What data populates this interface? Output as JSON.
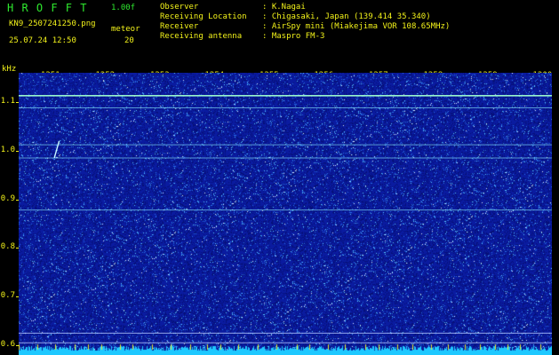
{
  "header": {
    "program_title": "H R O F F T",
    "version": "1.00f",
    "filename": "KN9_2507241250.png",
    "date_time": "25.07.24 12:50",
    "mode": "meteor",
    "count": "20"
  },
  "info": {
    "rows": [
      {
        "label": "Observer",
        "value": ": K.Nagai"
      },
      {
        "label": "Receiving Location",
        "value": ": Chigasaki, Japan (139.414 35.340)"
      },
      {
        "label": "Receiver",
        "value": ": AirSpy mini (Miakejima VOR 108.65MHz)"
      },
      {
        "label": "Receiving antenna",
        "value": ": Maspro FM-3"
      }
    ]
  },
  "chart_data": {
    "type": "heatmap",
    "ylabel": "kHz",
    "x_ticks": [
      "1251",
      "1252",
      "1253",
      "1254",
      "1255",
      "1256",
      "1257",
      "1258",
      "1259",
      "1300"
    ],
    "y_ticks": [
      "1.1",
      "1.0",
      "0.9",
      "0.8",
      "0.7",
      "0.6"
    ],
    "ylim": [
      0.58,
      1.16
    ],
    "carrier_lines_khz": [
      1.113,
      1.088,
      1.012,
      0.985,
      0.878,
      0.625,
      0.605
    ],
    "meteor_echo": {
      "time_start": "1253.75",
      "time_end": "1254.2",
      "freq_start_khz": 0.985,
      "freq_end_khz": 1.02
    },
    "colors": {
      "background": "#0a1ba0",
      "noise": "#5fd0ff",
      "carrier": "#8cf0ff",
      "axis_text": "#f2f21a",
      "title": "#2ee82e"
    }
  }
}
